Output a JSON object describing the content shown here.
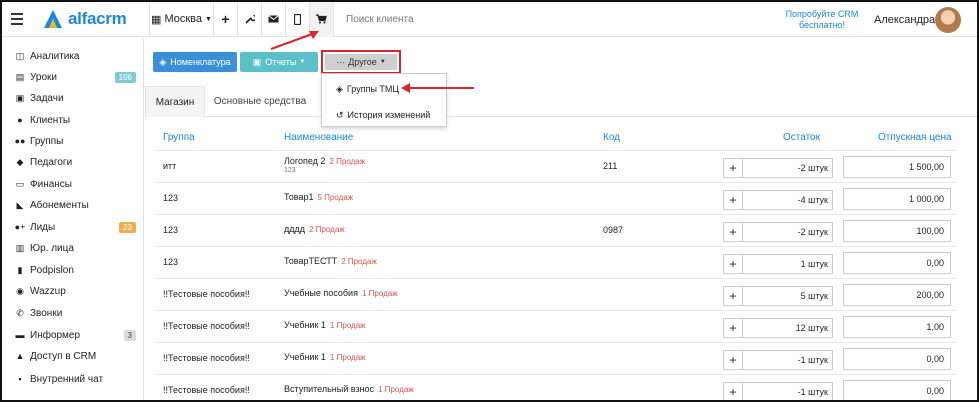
{
  "app": {
    "logo_text": "alfacrm"
  },
  "topbar": {
    "city": "Москва",
    "search_placeholder": "Поиск клиента",
    "promo": "Попробуйте CRM бесплатно!",
    "user": "Александра",
    "icons": [
      "plus-icon",
      "wrench-icon",
      "mail-icon",
      "phone-icon",
      "cart-icon"
    ]
  },
  "sidebar": {
    "items": [
      {
        "label": "Аналитика",
        "icon": "analytics-icon"
      },
      {
        "label": "Уроки",
        "icon": "calendar-icon",
        "badge": "106"
      },
      {
        "label": "Задачи",
        "icon": "tasks-icon"
      },
      {
        "label": "Клиенты",
        "icon": "user-icon"
      },
      {
        "label": "Группы",
        "icon": "group-icon"
      },
      {
        "label": "Педагоги",
        "icon": "graduation-icon"
      },
      {
        "label": "Финансы",
        "icon": "money-icon"
      },
      {
        "label": "Абонементы",
        "icon": "tag-icon"
      },
      {
        "label": "Лиды",
        "icon": "user-plus-icon",
        "badge": "23"
      },
      {
        "label": "Юр. лица",
        "icon": "building-icon"
      },
      {
        "label": "Podpislon",
        "icon": "doc-icon"
      },
      {
        "label": "Wazzup",
        "icon": "whatsapp-icon"
      },
      {
        "label": "Звонки",
        "icon": "phone-icon"
      },
      {
        "label": "Информер",
        "icon": "informer-icon",
        "badge": "3"
      },
      {
        "label": "Доступ в CRM",
        "icon": "lock-icon"
      },
      {
        "label": "Внутренний чат",
        "icon": "chat-icon"
      }
    ]
  },
  "toolbar": {
    "nomenclature": "Номенклатура",
    "reports": "Отчеты",
    "other": "Другое"
  },
  "dropdown": {
    "items": [
      "Группы ТМЦ",
      "История изменений"
    ]
  },
  "tabs": [
    "Магазин",
    "Основные средства"
  ],
  "table": {
    "headers": [
      "Группа",
      "Наименование",
      "Код",
      "Остаток",
      "Отпускная цена"
    ],
    "rows": [
      {
        "group": "итт",
        "name": "Логопед 2",
        "tag": "2 Продаж",
        "sub": "123",
        "code": "211",
        "qty": "-2 штук",
        "price": "1 500,00"
      },
      {
        "group": "123",
        "name": "Товар1",
        "tag": "5 Продаж",
        "sub": "",
        "code": "",
        "qty": "-4 штук",
        "price": "1 000,00"
      },
      {
        "group": "123",
        "name": "дддд",
        "tag": "2 Продаж",
        "sub": "",
        "code": "0987",
        "qty": "-2 штук",
        "price": "100,00"
      },
      {
        "group": "123",
        "name": "ТоварТЕСТТ",
        "tag": "2 Продаж",
        "sub": "",
        "code": "",
        "qty": "1 штук",
        "price": "0,00"
      },
      {
        "group": "!!Тестовые пособия!!",
        "name": "Учебные пособия",
        "tag": "1 Продаж",
        "sub": "",
        "code": "",
        "qty": "5 штук",
        "price": "200,00"
      },
      {
        "group": "!!Тестовые пособия!!",
        "name": "Учебник 1",
        "tag": "1 Продаж",
        "sub": "",
        "code": "",
        "qty": "12 штук",
        "price": "1,00"
      },
      {
        "group": "!!Тестовые пособия!!",
        "name": "Учебник 1",
        "tag": "1 Продаж",
        "sub": "",
        "code": "",
        "qty": "-1 штук",
        "price": "0,00"
      },
      {
        "group": "!!Тестовые пособия!!",
        "name": "Вступительный взнос",
        "tag": "1 Продаж",
        "sub": "",
        "code": "",
        "qty": "-1 штук",
        "price": "0,00"
      }
    ]
  },
  "colors": {
    "accent": "#1e88d8",
    "highlight": "#d9262b",
    "badge_blue": "#7ecbd6",
    "badge_orange": "#f0ad4e"
  }
}
